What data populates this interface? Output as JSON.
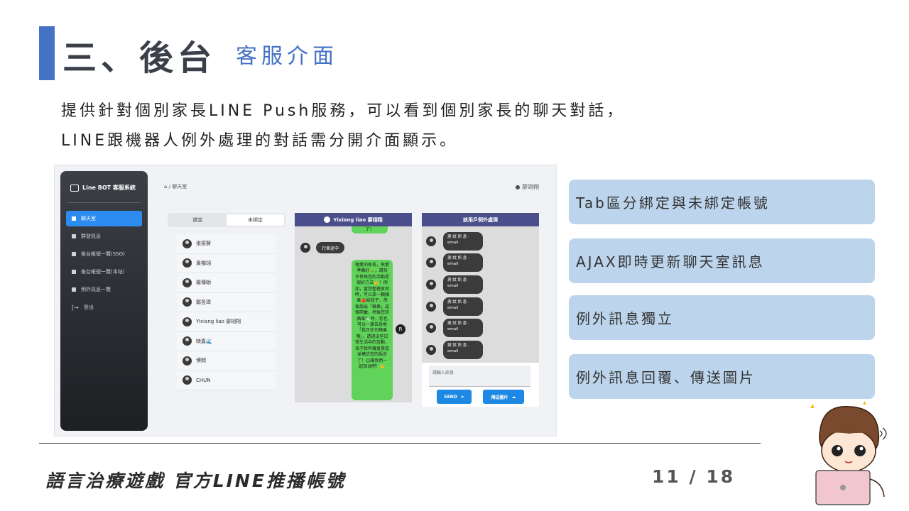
{
  "slide": {
    "title": "三、後台",
    "subtitle": "客服介面",
    "description_lines": [
      "提供針對個別家長LINE Push服務，可以看到個別家長的聊天對話，",
      "LINE跟機器人例外處理的對話需分開介面顯示。"
    ],
    "features": [
      "Tab區分綁定與未綁定帳號",
      "AJAX即時更新聊天室訊息",
      "例外訊息獨立",
      "例外訊息回覆、傳送圖片"
    ],
    "footer_text": "語言治療遊戲 官方LINE推播帳號",
    "page_number": "11 / 18"
  },
  "app": {
    "brand": "Line BOT 客服系統",
    "nav": [
      {
        "label": "聊天室",
        "active": true
      },
      {
        "label": "群發訊息",
        "active": false
      },
      {
        "label": "後台帳號一覽(SSO)",
        "active": false
      },
      {
        "label": "後台帳號一覽(本站)",
        "active": false
      },
      {
        "label": "例外訊息一覽",
        "active": false
      },
      {
        "label": "登出",
        "active": false
      }
    ],
    "breadcrumb": "⌂ / 聊天室",
    "current_user": "廖翊翔",
    "tabs": [
      "綁定",
      "未綁定"
    ],
    "contacts": [
      "張振賢",
      "黃楷翊",
      "羅傳勛",
      "鄭昱瑋",
      "Yixiang liao 廖翊翔",
      "映嘉🌊",
      "博問",
      "CHUN"
    ],
    "chat": {
      "header": "Yixiang liao 廖翊翔",
      "top_fragment": "了！",
      "status_bubble": "行車途中",
      "user_badge": "R",
      "long_message": "親愛的家長，熊愛準備好🐛，請孩子參與您的活動是很好方法👍！例如，當您整理食材時，可以拿一顆蘋果🍎給孩子，然後說出「蘋果」這個詞彙，然後您切蘋果🔪時，您也可以一邊告訴他「我正在切蘋果哦」，透過這些日常生活中的互動，孩子就有機會學習並模仿您的語言了！😊讓我們一起加油吧！💪"
    },
    "exceptions": {
      "header": "該用戶例外處理",
      "items": [
        "測 試 訊 息 ‧ email",
        "測 試 訊 息 ‧ email",
        "測 試 訊 息 ‧ email",
        "測 試 訊 息 ‧ email",
        "測 試 訊 息 ‧ email",
        "測 試 訊 息 ‧ email"
      ],
      "input_placeholder": "請輸入訊息",
      "send_label": "SEND",
      "image_label": "傳送圖片"
    }
  }
}
